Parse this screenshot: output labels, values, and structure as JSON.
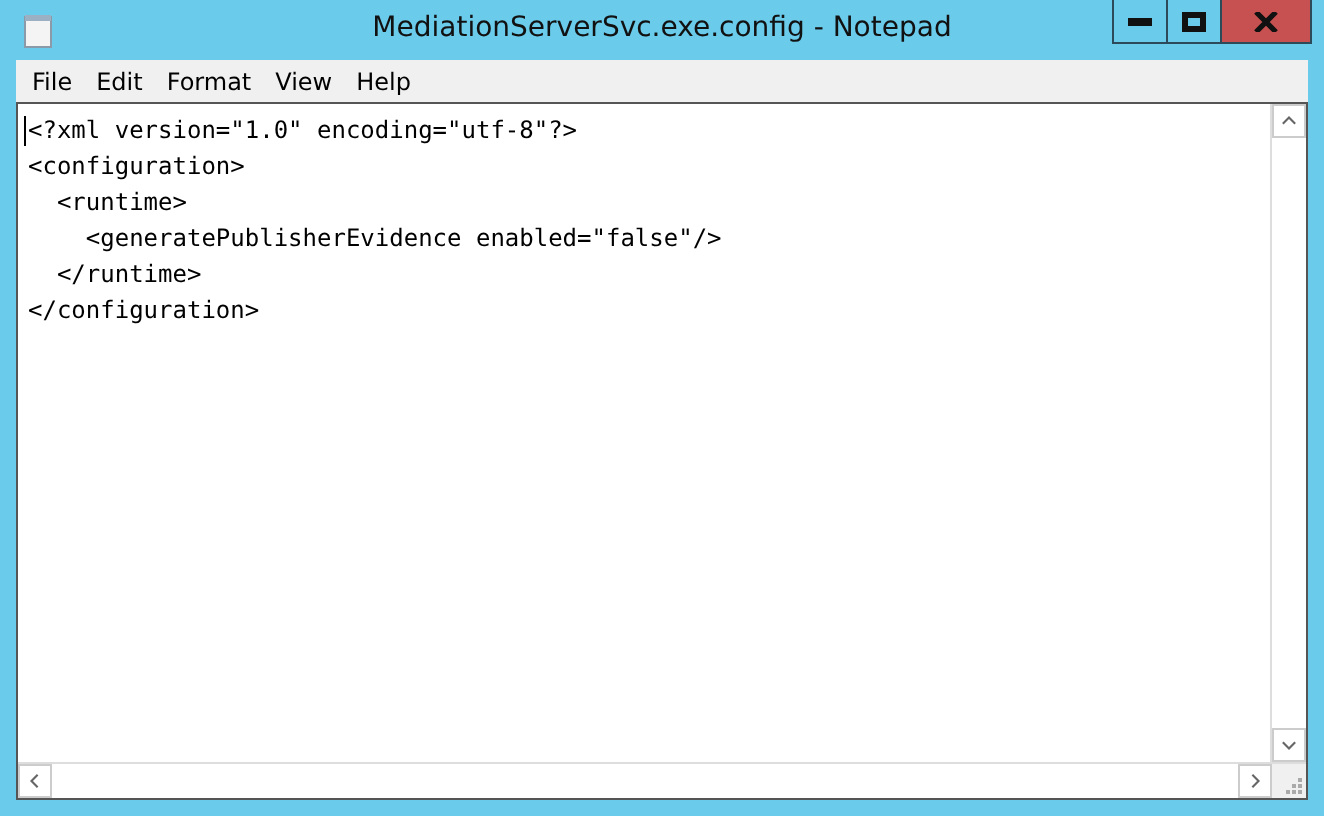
{
  "window": {
    "title": "MediationServerSvc.exe.config - Notepad"
  },
  "menu": [
    "File",
    "Edit",
    "Format",
    "View",
    "Help"
  ],
  "editor": {
    "lines": [
      "<?xml version=\"1.0\" encoding=\"utf-8\"?>",
      "<configuration>",
      "  <runtime>",
      "    <generatePublisherEvidence enabled=\"false\"/>",
      "  </runtime>",
      "</configuration>"
    ]
  }
}
